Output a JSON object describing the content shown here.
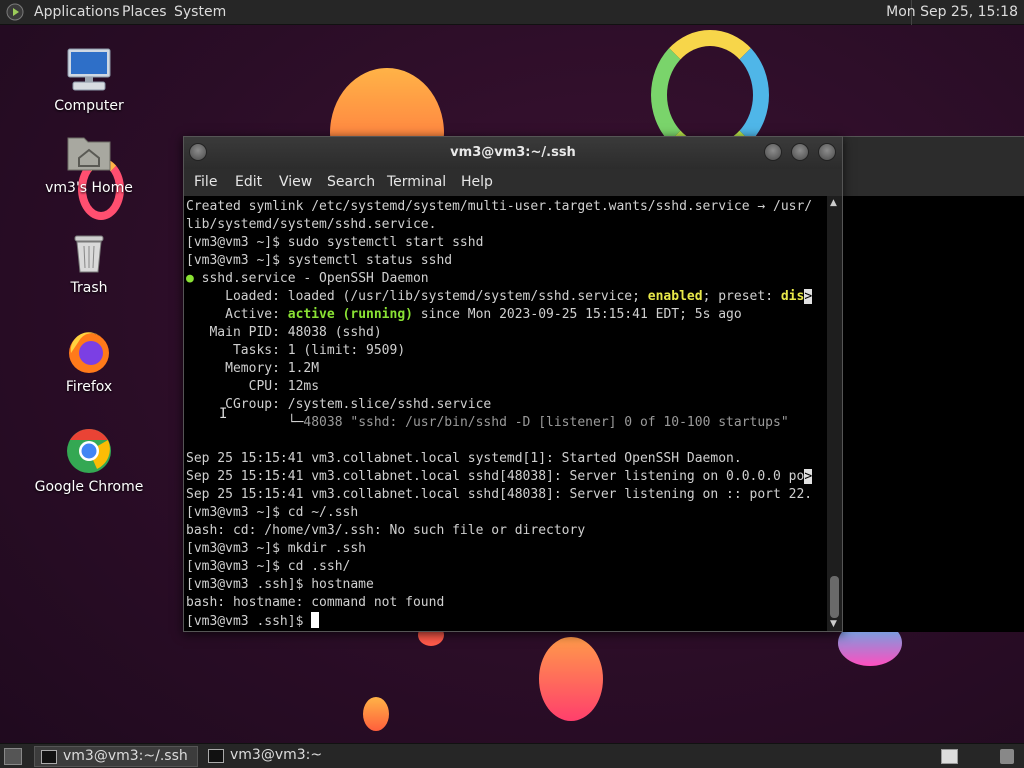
{
  "top_panel": {
    "menus": [
      "Applications",
      "Places",
      "System"
    ],
    "clock": "Mon Sep 25, 15:18"
  },
  "desktop_icons": [
    {
      "label": "Computer",
      "icon": "computer-icon"
    },
    {
      "label": "vm3's Home",
      "icon": "home-folder-icon"
    },
    {
      "label": "Trash",
      "icon": "trash-icon"
    },
    {
      "label": "Firefox",
      "icon": "firefox-icon"
    },
    {
      "label": "Google Chrome",
      "icon": "chrome-icon"
    }
  ],
  "terminal": {
    "title": "vm3@vm3:~/.ssh",
    "menu": [
      "File",
      "Edit",
      "View",
      "Search",
      "Terminal",
      "Help"
    ],
    "lines": [
      "Created symlink /etc/systemd/system/multi-user.target.wants/sshd.service → /usr/",
      "lib/systemd/system/sshd.service.",
      "[vm3@vm3 ~]$ sudo systemctl start sshd",
      "[vm3@vm3 ~]$ systemctl status sshd",
      "sshd.service - OpenSSH Daemon",
      "     Loaded: loaded (/usr/lib/systemd/system/sshd.service; ",
      "enabled",
      "; preset: ",
      "dis",
      ">",
      "     Active: ",
      "active (running)",
      " since Mon 2023-09-25 15:15:41 EDT; 5s ago",
      "   Main PID: 48038 (sshd)",
      "      Tasks: 1 (limit: 9509)",
      "     Memory: 1.2M",
      "        CPU: 12ms",
      "     CGroup: /system.slice/sshd.service",
      "             └─",
      "48038 \"sshd: /usr/bin/sshd -D [listener] 0 of 10-100 startups\"",
      "",
      "Sep 25 15:15:41 vm3.collabnet.local systemd[1]: Started OpenSSH Daemon.",
      "Sep 25 15:15:41 vm3.collabnet.local sshd[48038]: Server listening on 0.0.0.0 po",
      "Sep 25 15:15:41 vm3.collabnet.local sshd[48038]: Server listening on :: port 22.",
      "[vm3@vm3 ~]$ cd ~/.ssh",
      "bash: cd: /home/vm3/.ssh: No such file or directory",
      "[vm3@vm3 ~]$ mkdir .ssh",
      "[vm3@vm3 ~]$ cd .ssh/",
      "[vm3@vm3 .ssh]$ hostname",
      "bash: hostname: command not found",
      "[vm3@vm3 .ssh]$ "
    ],
    "status_dot": "●",
    "scroll_up": "▲",
    "scroll_down": "▼"
  },
  "taskbar": {
    "tasks": [
      "vm3@vm3:~/.ssh",
      "vm3@vm3:~"
    ]
  },
  "mouse_glyph": "I",
  "colors": {
    "panel": "#262626",
    "terminal_bg": "#000000",
    "ok_green": "#8ae234",
    "enabled_yellow": "#e8e84a"
  }
}
